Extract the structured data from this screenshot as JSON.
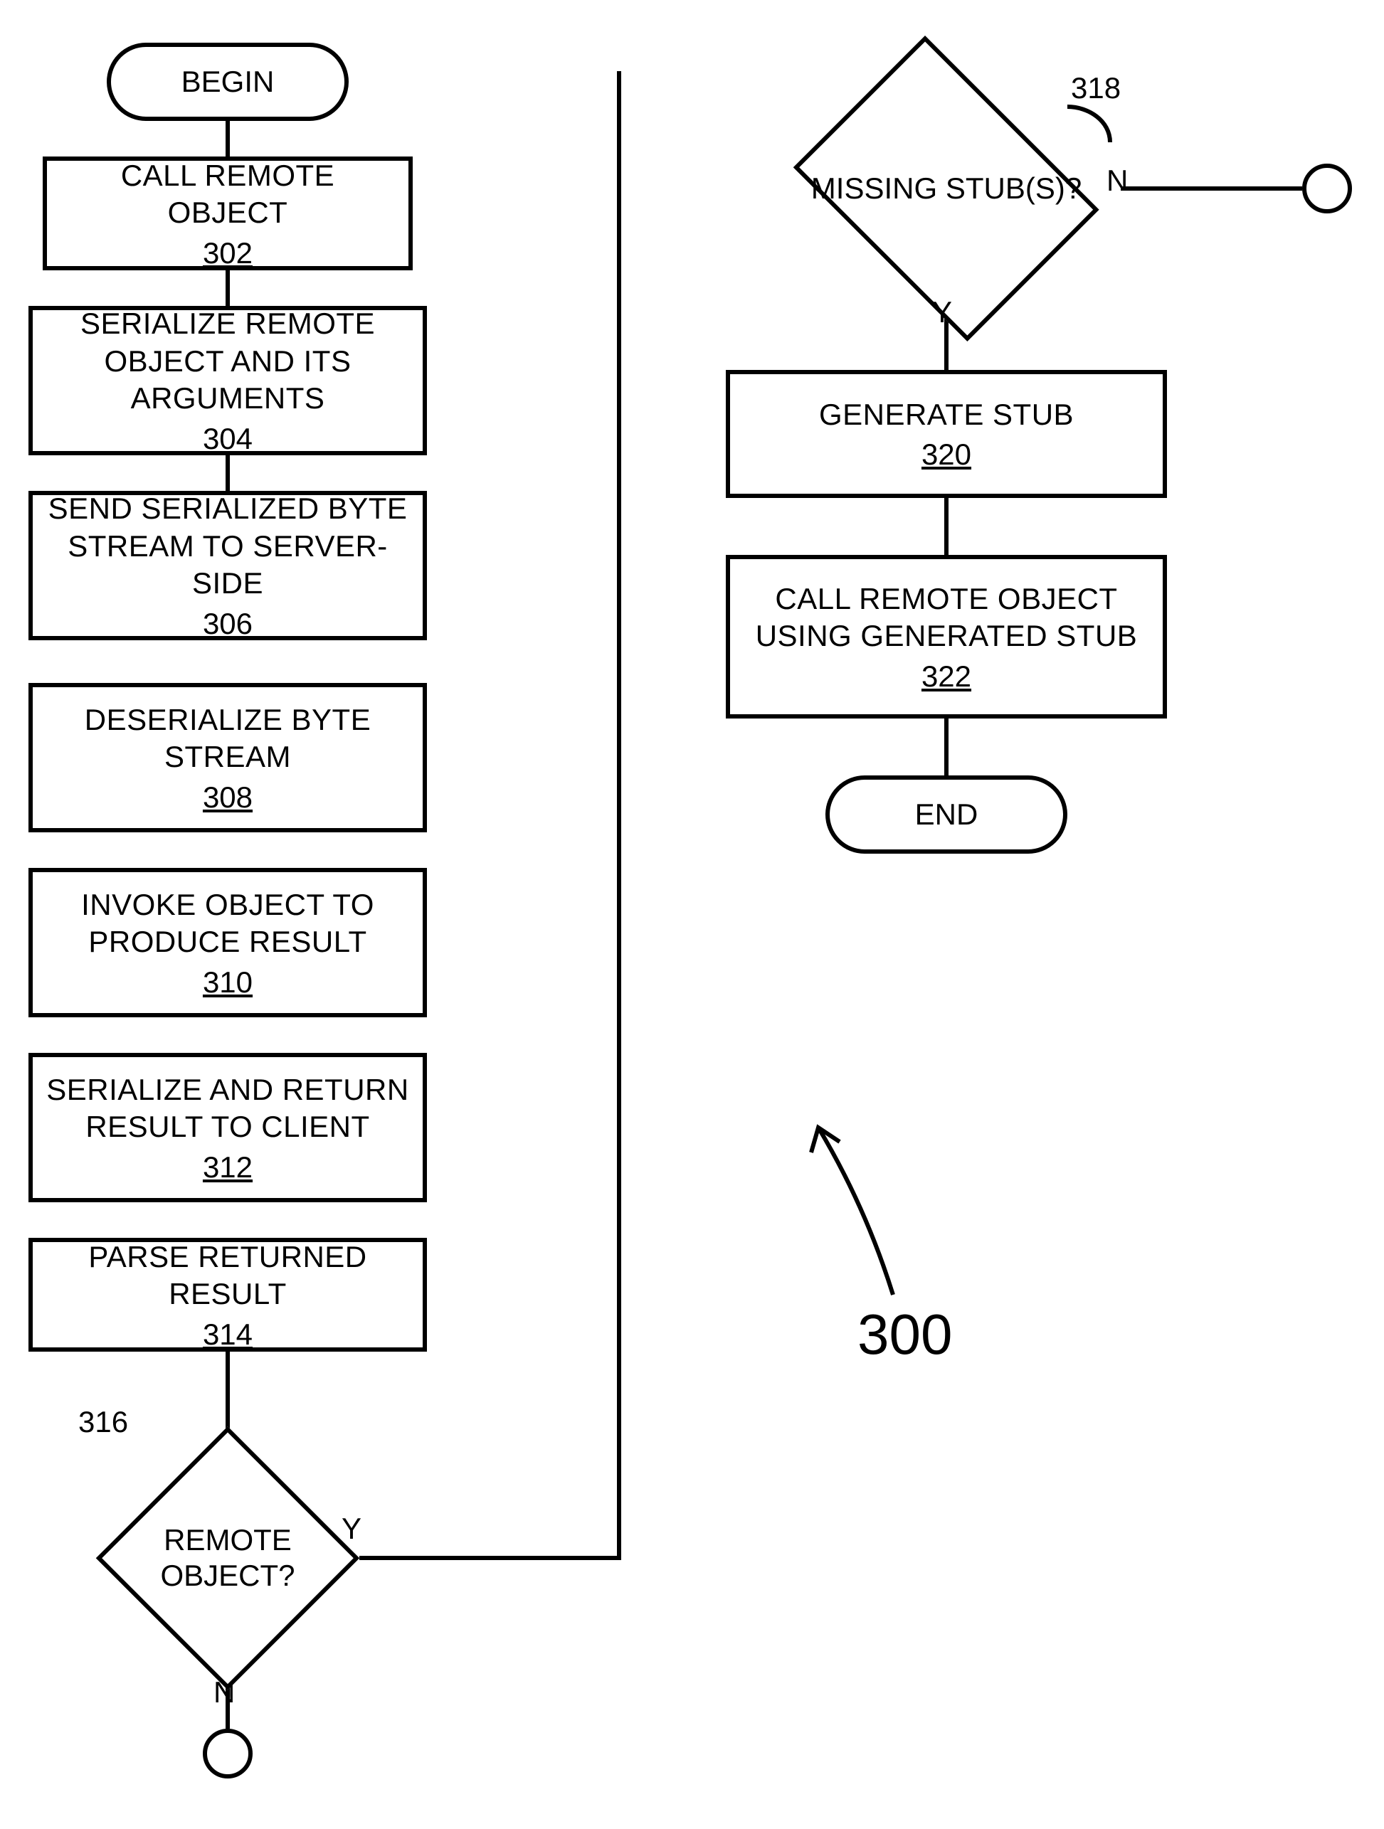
{
  "figure_ref": "300",
  "terminators": {
    "begin": "BEGIN",
    "end": "END"
  },
  "processes": {
    "p302": {
      "text": "CALL REMOTE OBJECT",
      "ref": "302"
    },
    "p304": {
      "text": "SERIALIZE REMOTE OBJECT AND ITS ARGUMENTS",
      "ref": "304"
    },
    "p306": {
      "text": "SEND SERIALIZED BYTE STREAM TO SERVER-SIDE",
      "ref": "306"
    },
    "p308": {
      "text": "DESERIALIZE BYTE STREAM",
      "ref": "308"
    },
    "p310": {
      "text": "INVOKE OBJECT TO PRODUCE RESULT",
      "ref": "310"
    },
    "p312": {
      "text": "SERIALIZE AND RETURN RESULT TO CLIENT",
      "ref": "312"
    },
    "p314": {
      "text": "PARSE RETURNED RESULT",
      "ref": "314"
    },
    "p320": {
      "text": "GENERATE STUB",
      "ref": "320"
    },
    "p322": {
      "text": "CALL REMOTE OBJECT USING GENERATED STUB",
      "ref": "322"
    }
  },
  "decisions": {
    "d316": {
      "text": "REMOTE OBJECT?",
      "ref": "316",
      "yes": "Y",
      "no": "N"
    },
    "d318": {
      "text": "MISSING STUB(S)?",
      "ref": "318",
      "yes": "Y",
      "no": "N"
    }
  }
}
